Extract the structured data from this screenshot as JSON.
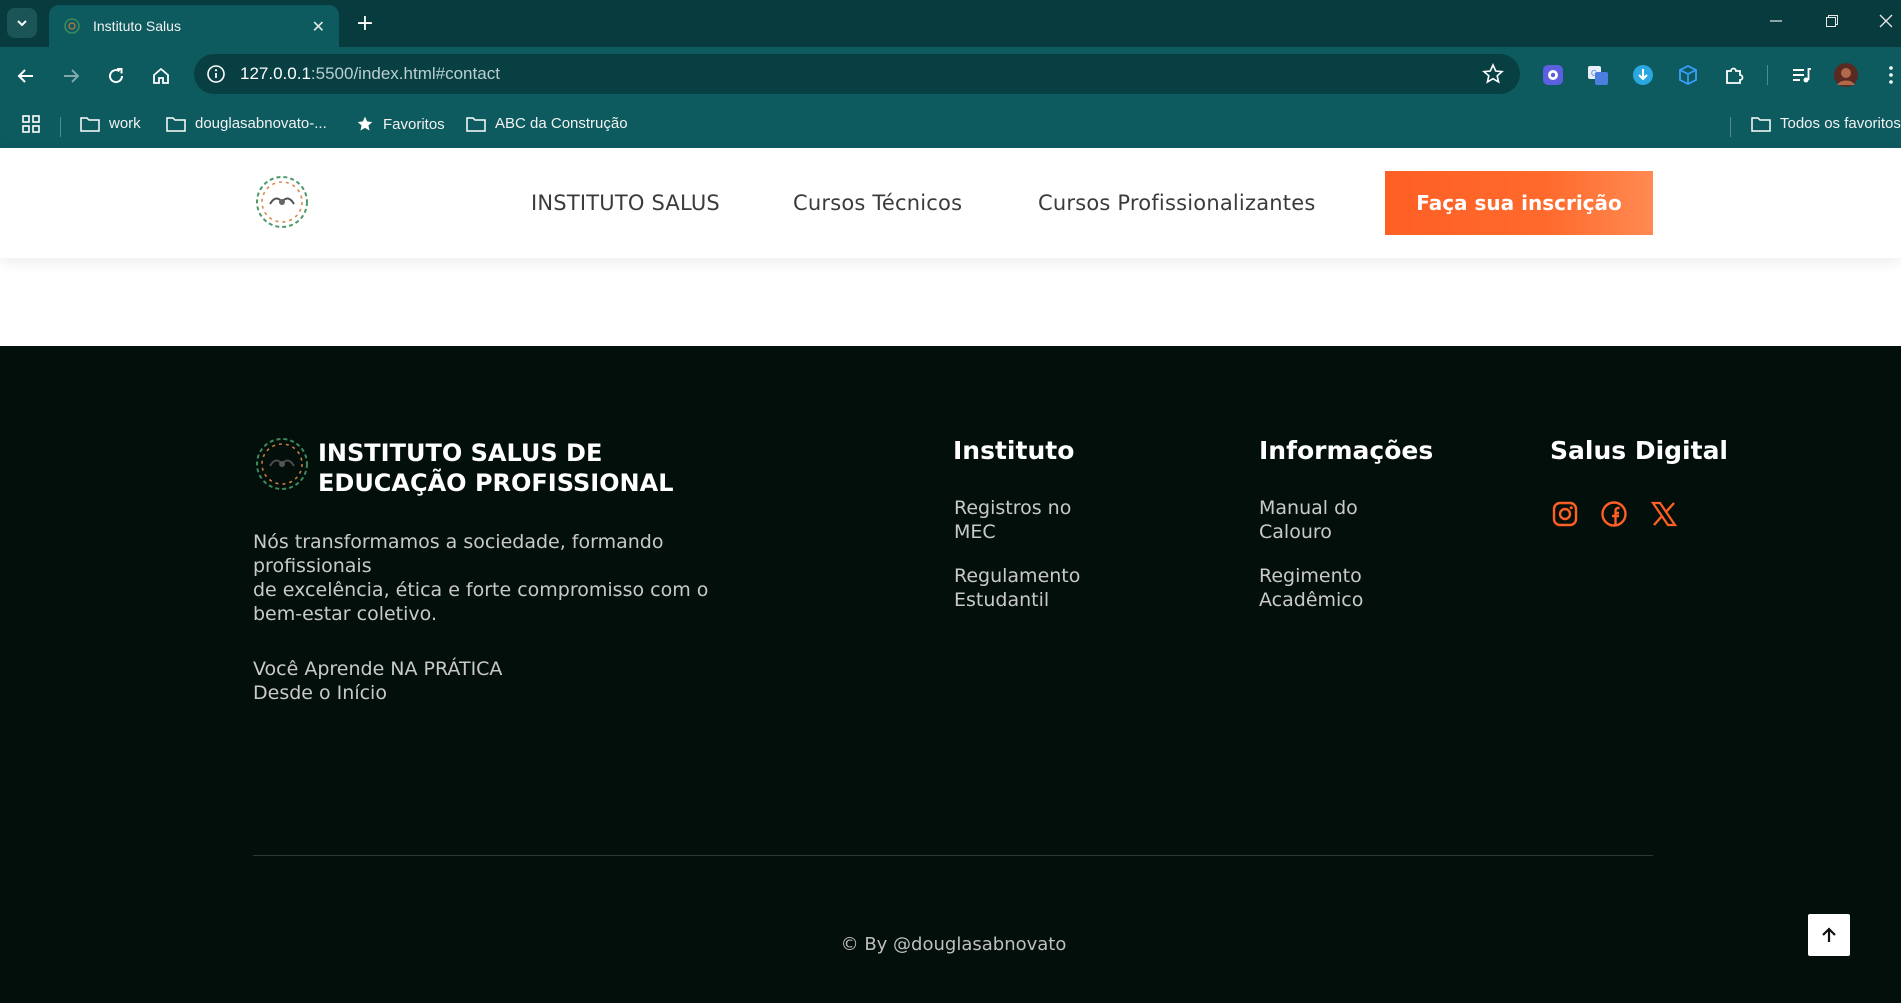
{
  "browser": {
    "tab_title": "Instituto Salus",
    "url_host": "127.0.0.1",
    "url_rest": ":5500/index.html#contact",
    "bookmarks": [
      {
        "label": "work"
      },
      {
        "label": "douglasabnovato-..."
      },
      {
        "label": "Favoritos"
      },
      {
        "label": "ABC da Construção"
      }
    ],
    "all_bookmarks_label": "Todos os favoritos"
  },
  "header": {
    "nav": [
      "INSTITUTO SALUS",
      "Cursos Técnicos",
      "Cursos Profissionalizantes"
    ],
    "cta_label": "Faça sua inscrição"
  },
  "footer": {
    "brand_line1": "INSTITUTO SALUS DE",
    "brand_line2": "EDUCAÇÃO PROFISSIONAL",
    "about_line1": "Nós transformamos a sociedade, formando profissionais",
    "about_line2": "de excelência, ética e forte compromisso com o bem-estar coletivo.",
    "tagline": "Você Aprende NA PRÁTICA Desde o Início",
    "columns": [
      {
        "title": "Instituto",
        "links": [
          "Registros no MEC",
          "Regulamento Estudantil"
        ]
      },
      {
        "title": "Informações",
        "links": [
          "Manual do Calouro",
          "Regimento Acadêmico"
        ]
      },
      {
        "title": "Salus Digital",
        "social": [
          "instagram-icon",
          "facebook-icon",
          "x-icon"
        ]
      }
    ],
    "copyright": "© By @douglasabnovato"
  },
  "colors": {
    "accent": "#ff5f24",
    "footer_bg": "#030f0a",
    "chrome_bg": "#0d5a5f"
  }
}
